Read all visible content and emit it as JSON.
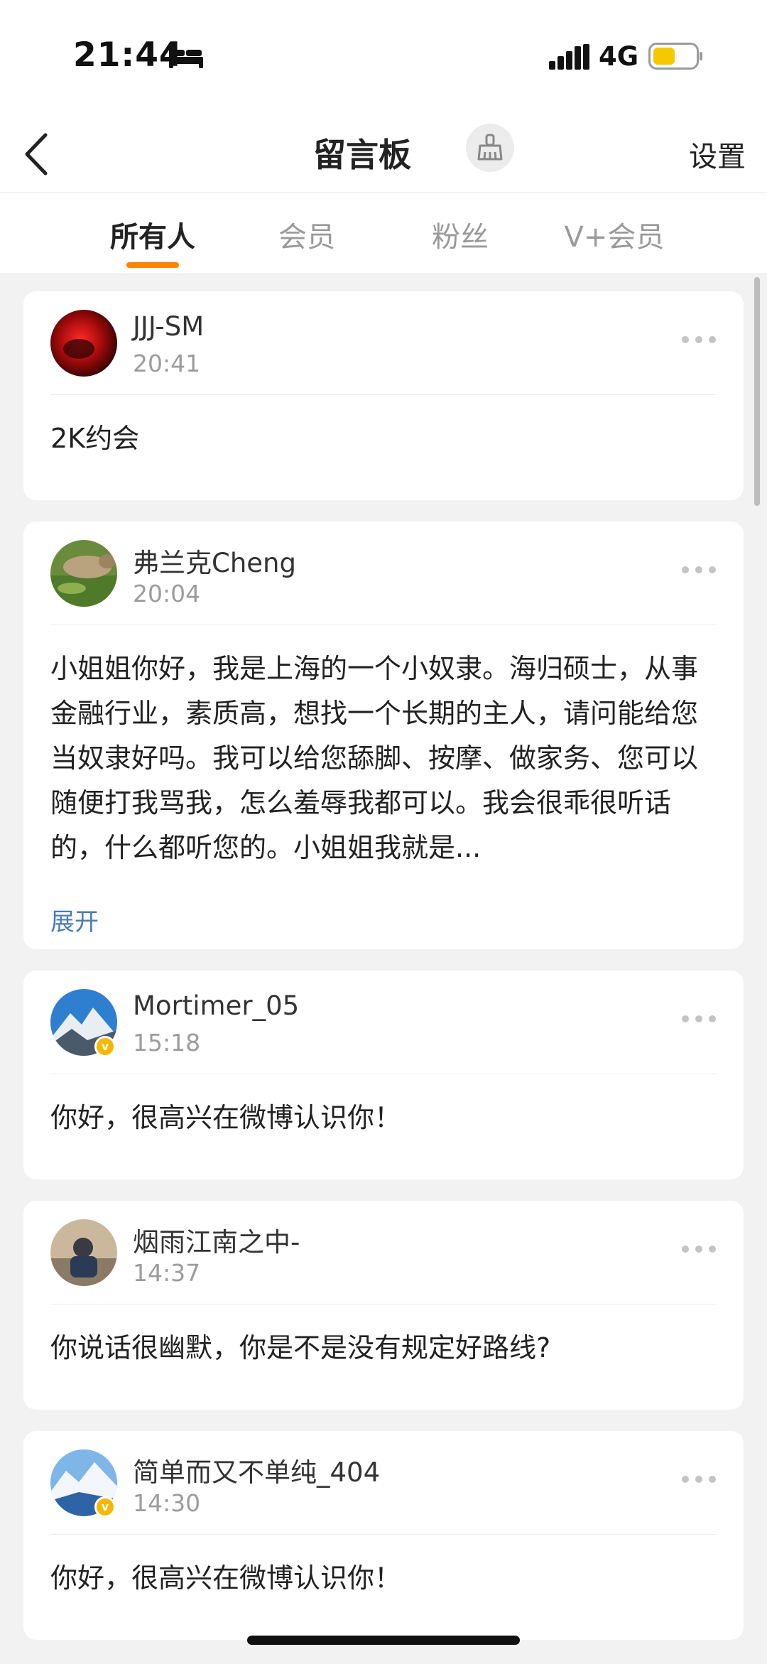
{
  "status_bar": {
    "time": "21:44",
    "network": "4G",
    "icons": [
      "bed-icon",
      "signal-icon",
      "battery-icon"
    ]
  },
  "nav": {
    "title": "留言板",
    "settings_label": "设置",
    "icons": [
      "back-icon",
      "broom-icon"
    ]
  },
  "tabs": [
    {
      "label": "所有人",
      "active": true
    },
    {
      "label": "会员",
      "active": false
    },
    {
      "label": "粉丝",
      "active": false
    },
    {
      "label": "V+会员",
      "active": false
    }
  ],
  "messages": [
    {
      "user": "JJJ-SM",
      "time": "20:41",
      "text": "2K约会",
      "verified": false
    },
    {
      "user": "弗兰克Cheng",
      "time": "20:04",
      "text": "小姐姐你好，我是上海的一个小奴隶。海归硕士，从事金融行业，素质高，想找一个长期的主人，请问能给您当奴隶好吗。我可以给您舔脚、按摩、做家务、您可以随便打我骂我，怎么羞辱我都可以。我会很乖很听话的，什么都听您的。小姐姐我就是...",
      "verified": false,
      "expand_label": "展开"
    },
    {
      "user": "Mortimer_05",
      "time": "15:18",
      "text": "你好，很高兴在微博认识你！",
      "verified": true
    },
    {
      "user": "烟雨江南之中-",
      "time": "14:37",
      "text": "你说话很幽默，你是不是没有规定好路线?",
      "verified": false
    },
    {
      "user": "简单而又不单纯_404",
      "time": "14:30",
      "text": "你好，很高兴在微博认识你！",
      "verified": true
    }
  ],
  "colors": {
    "accent": "#ff8200",
    "link": "#4b7cb4",
    "verified_badge": "#f5b800",
    "background": "#f2f2f2"
  }
}
